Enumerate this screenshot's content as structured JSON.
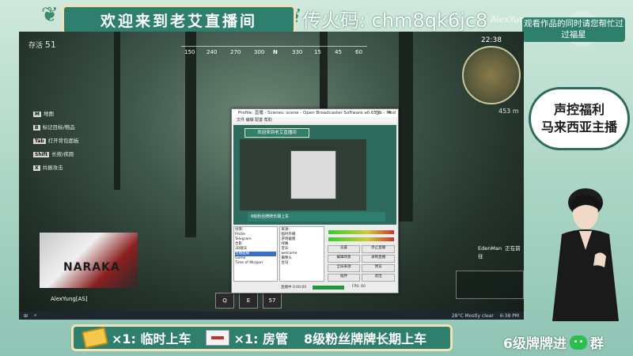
{
  "overlay": {
    "title": "欢迎来到老艾直播间",
    "code_text": "传火码: chm8qk6jc8",
    "watermark": "AlexYung",
    "side_top_banner": "观看作品的同时请您帮忙过过福星",
    "bubble_lines": [
      "声控福利",
      "马来西亚主播"
    ],
    "bottom_banner": {
      "item1": "×1: 临时上车",
      "item2": "×1: 房管",
      "item3": "8级粉丝牌牌长期上车"
    },
    "bottom_right": "6级牌牌进",
    "bottom_right_tail": "群",
    "colors": {
      "teal": "#2f7f6f",
      "cream": "#f1e2b3",
      "mint": "#bfe0d0"
    }
  },
  "game": {
    "alive_label": "存活",
    "alive_count": "51",
    "timer": "22:38",
    "compass_marks": [
      "150",
      "240",
      "270",
      "300",
      "N",
      "330",
      "15",
      "45",
      "60"
    ],
    "menu": [
      {
        "key": "M",
        "label": "地图"
      },
      {
        "key": "B",
        "label": "标记目标/物品"
      },
      {
        "key": "Tab",
        "label": "打开背包面板"
      },
      {
        "key": "Shift",
        "label": "长按/疾跑"
      },
      {
        "key": "X",
        "label": "共振攻击"
      }
    ],
    "banner_logo": "NARAKA",
    "player_name": "AlexYung[AS]",
    "skills": [
      "Q",
      "E",
      "57"
    ],
    "teammate_name": "EdenMan",
    "teammate_status": "正在前往",
    "distance": "453 m",
    "taskbar_status": "28°C Mostly clear",
    "taskbar_time": "6:38 PM"
  },
  "obs": {
    "window_title": "Profile: 直播 - Scenes: scene - Open Broadcaster Software v0.659b - Mod",
    "menu": "文件 编辑 配置 帮助",
    "scenes_header": "场景:",
    "scenes": [
      "ProSe",
      "Telegram",
      "合影",
      "3D聊天",
      "主播直播",
      "Game",
      "Time of Mirajorr"
    ],
    "sources_header": "来源:",
    "sources": [
      "临时开播",
      "游戏截图",
      "绿幕",
      "音乐",
      "welcome",
      "摄像头",
      "台词"
    ],
    "controls": [
      "设置",
      "停止直播",
      "编辑场景",
      "录制直播",
      "全局来源",
      "预览",
      "插件",
      "退出"
    ],
    "status": "直播中 0:00:00",
    "fps": "FPS: 60"
  }
}
